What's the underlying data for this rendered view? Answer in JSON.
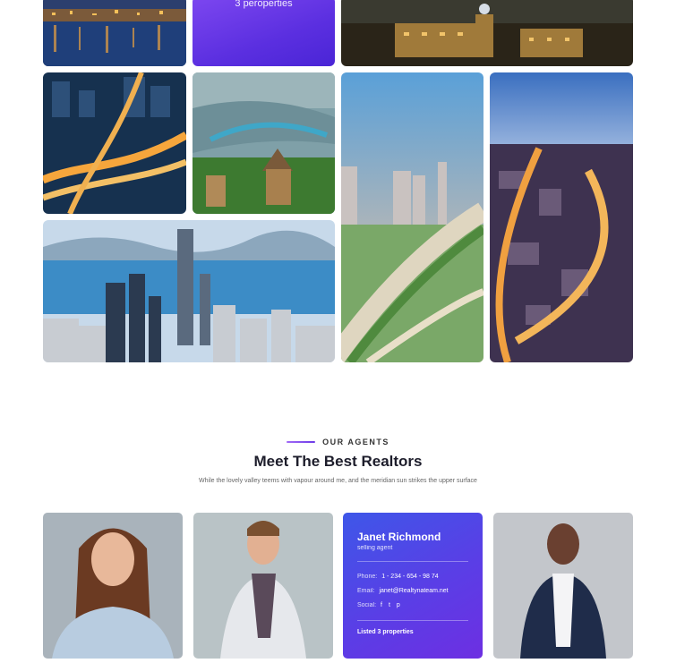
{
  "gallery": {
    "featured_tile": {
      "count_label": "3 peroperties"
    }
  },
  "agents_section": {
    "eyebrow": "OUR AGENTS",
    "title": "Meet The Best Realtors",
    "subtitle": "While the lovely valley teems with vapour around me, and the meridian sun strikes the upper surface"
  },
  "agent_card": {
    "name": "Janet Richmond",
    "role": "selling agent",
    "phone_label": "Phone:",
    "phone": "1 - 234 - 654 - 98 74",
    "email_label": "Email:",
    "email": "janet@Realtynateam.net",
    "social_label": "Social:",
    "social_icons": [
      "facebook-icon",
      "twitter-icon",
      "pinterest-icon"
    ],
    "social_glyphs": [
      "f",
      "t",
      "p"
    ],
    "listed": "Listed 3 properties"
  },
  "colors": {
    "accent_purple": "#6d3be6",
    "card_gradient_start": "#3e57e8",
    "card_gradient_end": "#6d2fe2",
    "heading": "#1d1d2b"
  }
}
